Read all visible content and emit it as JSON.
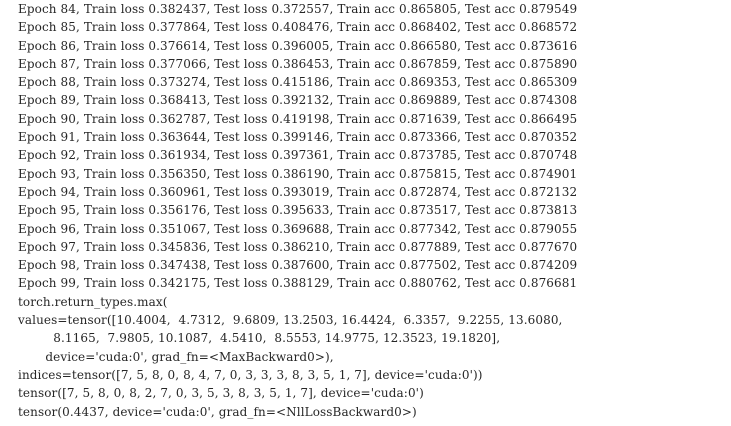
{
  "console": {
    "lines": [
      "Epoch 84, Train loss 0.382437, Test loss 0.372557, Train acc 0.865805, Test acc 0.879549",
      "Epoch 85, Train loss 0.377864, Test loss 0.408476, Train acc 0.868402, Test acc 0.868572",
      "Epoch 86, Train loss 0.376614, Test loss 0.396005, Train acc 0.866580, Test acc 0.873616",
      "Epoch 87, Train loss 0.377066, Test loss 0.386453, Train acc 0.867859, Test acc 0.875890",
      "Epoch 88, Train loss 0.373274, Test loss 0.415186, Train acc 0.869353, Test acc 0.865309",
      "Epoch 89, Train loss 0.368413, Test loss 0.392132, Train acc 0.869889, Test acc 0.874308",
      "Epoch 90, Train loss 0.362787, Test loss 0.419198, Train acc 0.871639, Test acc 0.866495",
      "Epoch 91, Train loss 0.363644, Test loss 0.399146, Train acc 0.873366, Test acc 0.870352",
      "Epoch 92, Train loss 0.361934, Test loss 0.397361, Train acc 0.873785, Test acc 0.870748",
      "Epoch 93, Train loss 0.356350, Test loss 0.386190, Train acc 0.875815, Test acc 0.874901",
      "Epoch 94, Train loss 0.360961, Test loss 0.393019, Train acc 0.872874, Test acc 0.872132",
      "Epoch 95, Train loss 0.356176, Test loss 0.395633, Train acc 0.873517, Test acc 0.873813",
      "Epoch 96, Train loss 0.351067, Test loss 0.369688, Train acc 0.877342, Test acc 0.879055",
      "Epoch 97, Train loss 0.345836, Test loss 0.386210, Train acc 0.877889, Test acc 0.877670",
      "Epoch 98, Train loss 0.347438, Test loss 0.387600, Train acc 0.877502, Test acc 0.874209",
      "Epoch 99, Train loss 0.342175, Test loss 0.388129, Train acc 0.880762, Test acc 0.876681",
      "torch.return_types.max(",
      "values=tensor([10.4004,  4.7312,  9.6809, 13.2503, 16.4424,  6.3357,  9.2255, 13.6080,",
      "         8.1165,  7.9805, 10.1087,  4.5410,  8.5553, 14.9775, 12.3523, 19.1820],",
      "       device='cuda:0', grad_fn=<MaxBackward0>),",
      "indices=tensor([7, 5, 8, 0, 8, 4, 7, 0, 3, 3, 3, 8, 3, 5, 1, 7], device='cuda:0'))",
      "tensor([7, 5, 8, 0, 8, 2, 7, 0, 3, 5, 3, 8, 3, 5, 1, 7], device='cuda:0')",
      "tensor(0.4437, device='cuda:0', grad_fn=<NllLossBackward0>)"
    ]
  }
}
